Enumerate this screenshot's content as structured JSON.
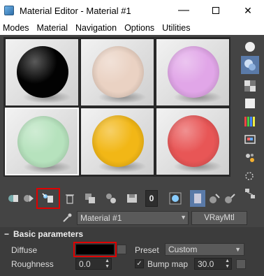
{
  "window": {
    "title": "Material Editor - Material #1",
    "controls": {
      "minimize": "—",
      "close": "✕"
    }
  },
  "menubar": [
    "Modes",
    "Material",
    "Navigation",
    "Options",
    "Utilities"
  ],
  "slots": [
    {
      "name": "slot-black",
      "color": "#020202",
      "selected": false
    },
    {
      "name": "slot-beige",
      "color": "#ead2c3",
      "selected": false
    },
    {
      "name": "slot-pink",
      "color": "#e1a6e8",
      "selected": false
    },
    {
      "name": "slot-mint",
      "color": "#b6e2bd",
      "selected": true
    },
    {
      "name": "slot-yellow",
      "color": "#f2b716",
      "selected": false
    },
    {
      "name": "slot-red",
      "color": "#e85656",
      "selected": false
    }
  ],
  "material": {
    "name": "Material #1",
    "type": "VRayMtl"
  },
  "toolbar": {
    "slot_number": "0"
  },
  "basic_parameters": {
    "header": "Basic parameters",
    "diffuse_label": "Diffuse",
    "diffuse_color": "#000000",
    "preset_label": "Preset",
    "preset_value": "Custom",
    "roughness_label": "Roughness",
    "roughness_value": "0.0",
    "bump_map_label": "Bump map",
    "bump_map_checked": "✓",
    "bump_map_value": "30.0"
  },
  "colors": {
    "highlight": "#e00000",
    "active_tool": "#5a7aa8"
  }
}
